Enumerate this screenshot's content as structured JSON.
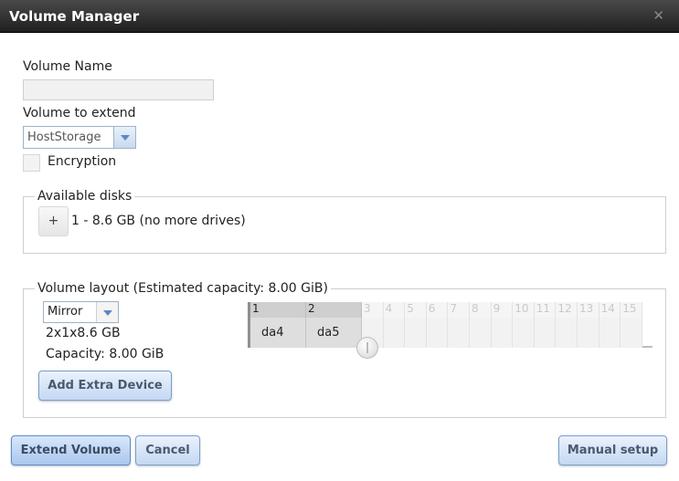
{
  "dialog": {
    "title": "Volume Manager",
    "close_glyph": "✕"
  },
  "form": {
    "volume_name_label": "Volume Name",
    "volume_name_value": "",
    "volume_to_extend_label": "Volume to extend",
    "volume_to_extend_value": "HostStorage",
    "encryption_label": "Encryption",
    "encryption_checked": false
  },
  "available_disks": {
    "legend": "Available disks",
    "add_button_label": "+",
    "summary": "1 - 8.6 GB (no more drives)"
  },
  "volume_layout": {
    "legend": "Volume layout (Estimated capacity: 8.00 GiB)",
    "layout_type": "Mirror",
    "config": "2x1x8.6 GB",
    "capacity": "Capacity: 8.00 GiB",
    "add_extra_device_label": "Add Extra Device",
    "columns": [
      "1",
      "2",
      "3",
      "4",
      "5",
      "6",
      "7",
      "8",
      "9",
      "10",
      "11",
      "12",
      "13",
      "14",
      "15"
    ],
    "disks": [
      "da4",
      "da5"
    ]
  },
  "footer": {
    "extend_volume_label": "Extend Volume",
    "cancel_label": "Cancel",
    "manual_setup_label": "Manual setup"
  },
  "colors": {
    "titlebar": "#2e2e2e",
    "button_blue": "#c4d8f2"
  }
}
